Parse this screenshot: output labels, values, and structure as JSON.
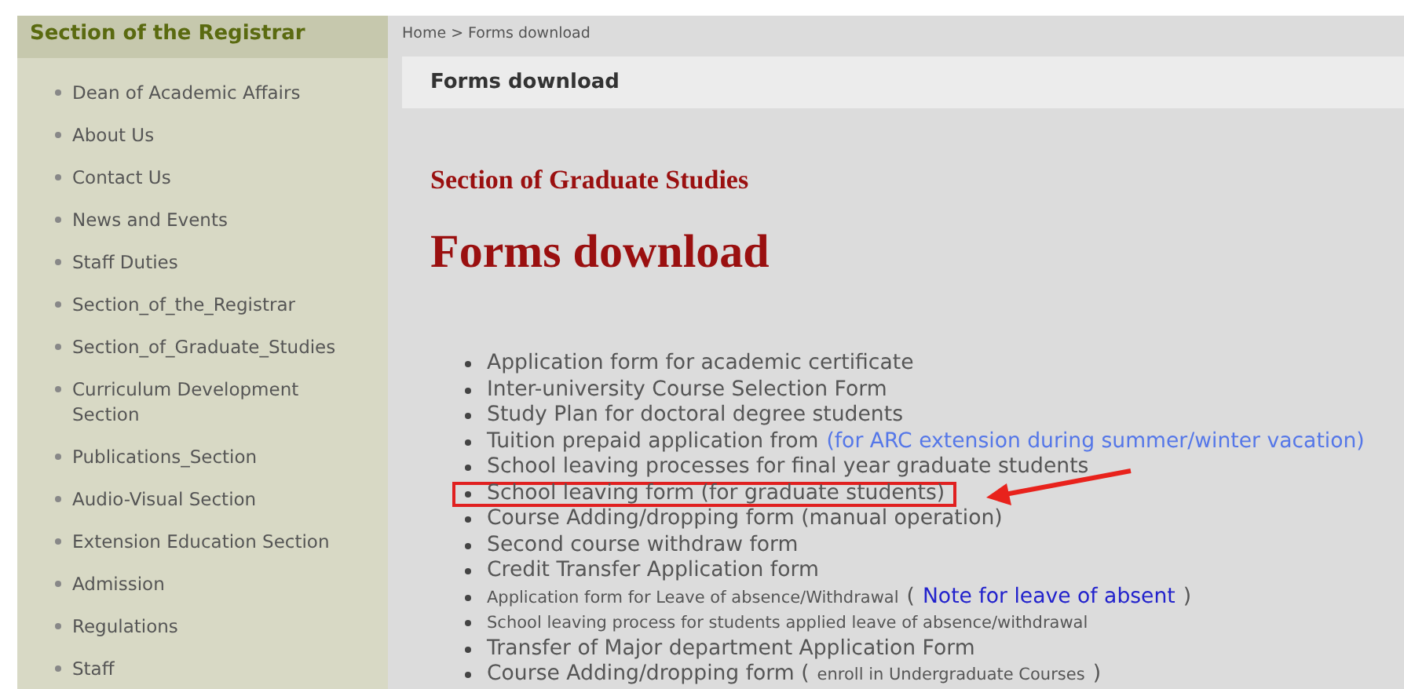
{
  "sidebar": {
    "title": "Section of the Registrar",
    "items": [
      {
        "label": "Dean of Academic Affairs"
      },
      {
        "label": "About Us"
      },
      {
        "label": "Contact Us"
      },
      {
        "label": "News and Events"
      },
      {
        "label": "Staff Duties"
      },
      {
        "label": "Section_of_the_Registrar"
      },
      {
        "label": "Section_of_Graduate_Studies"
      },
      {
        "label": "Curriculum Development Section"
      },
      {
        "label": "Publications_Section"
      },
      {
        "label": "Audio-Visual Section"
      },
      {
        "label": "Extension Education Section"
      },
      {
        "label": "Admission"
      },
      {
        "label": "Regulations"
      },
      {
        "label": "Staff"
      }
    ]
  },
  "breadcrumb": "Home > Forms download",
  "page_title": "Forms download",
  "section_heading": "Section of Graduate Studies",
  "heading": "Forms download",
  "forms": [
    {
      "highlighted": false,
      "parts": [
        {
          "kind": "plain",
          "text": "Application form for academic certificate"
        }
      ]
    },
    {
      "highlighted": false,
      "parts": [
        {
          "kind": "plain",
          "text": "Inter-university Course Selection Form"
        }
      ]
    },
    {
      "highlighted": false,
      "parts": [
        {
          "kind": "plain",
          "text": "Study Plan for doctoral degree students"
        }
      ]
    },
    {
      "highlighted": false,
      "parts": [
        {
          "kind": "plain",
          "text": "Tuition prepaid application from"
        },
        {
          "kind": "link",
          "text": "(for ARC extension during summer/winter vacation)"
        }
      ]
    },
    {
      "highlighted": false,
      "parts": [
        {
          "kind": "plain",
          "text": "School leaving processes for final year graduate students"
        }
      ]
    },
    {
      "highlighted": true,
      "parts": [
        {
          "kind": "plain",
          "text": "School leaving form (for graduate students)"
        }
      ]
    },
    {
      "highlighted": false,
      "parts": [
        {
          "kind": "plain",
          "text": "Course Adding/dropping form (manual operation)"
        }
      ]
    },
    {
      "highlighted": false,
      "parts": [
        {
          "kind": "plain",
          "text": "Second course withdraw form"
        }
      ]
    },
    {
      "highlighted": false,
      "parts": [
        {
          "kind": "plain",
          "text": "Credit Transfer Application form"
        }
      ]
    },
    {
      "highlighted": false,
      "parts": [
        {
          "kind": "small",
          "text": "Application form for Leave of absence/Withdrawal"
        },
        {
          "kind": "plain",
          "text": "("
        },
        {
          "kind": "note-link",
          "text": "Note for leave of absent"
        },
        {
          "kind": "plain",
          "text": ")"
        }
      ]
    },
    {
      "highlighted": false,
      "parts": [
        {
          "kind": "small",
          "text": "School leaving process for students applied leave of absence/withdrawal"
        }
      ]
    },
    {
      "highlighted": false,
      "parts": [
        {
          "kind": "plain",
          "text": "Transfer of Major department Application Form"
        }
      ]
    },
    {
      "highlighted": false,
      "parts": [
        {
          "kind": "plain",
          "text": "Course Adding/dropping form ("
        },
        {
          "kind": "small",
          "text": "enroll in Undergraduate Courses"
        },
        {
          "kind": "plain",
          "text": ")"
        }
      ]
    }
  ]
}
